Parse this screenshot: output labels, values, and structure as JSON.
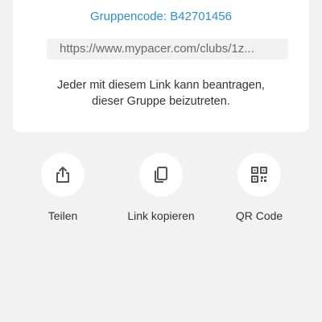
{
  "card": {
    "title_partial": "",
    "group_code": "Gruppencode: B42701456",
    "link": "https://www.mypacer.com/clubs/1z...",
    "description_line1": "Jeder mit diesem Link kann beantragen,",
    "description_line2": "dieser Gruppe beizutreten."
  },
  "actions": [
    {
      "label": "Teilen",
      "icon": "share-icon"
    },
    {
      "label": "Link kopieren",
      "icon": "copy-icon"
    },
    {
      "label": "QR Code",
      "icon": "qr-code-icon"
    }
  ],
  "colors": {
    "accent": "#2a8fd6",
    "background": "#f2f2f2",
    "card": "#ffffff"
  }
}
